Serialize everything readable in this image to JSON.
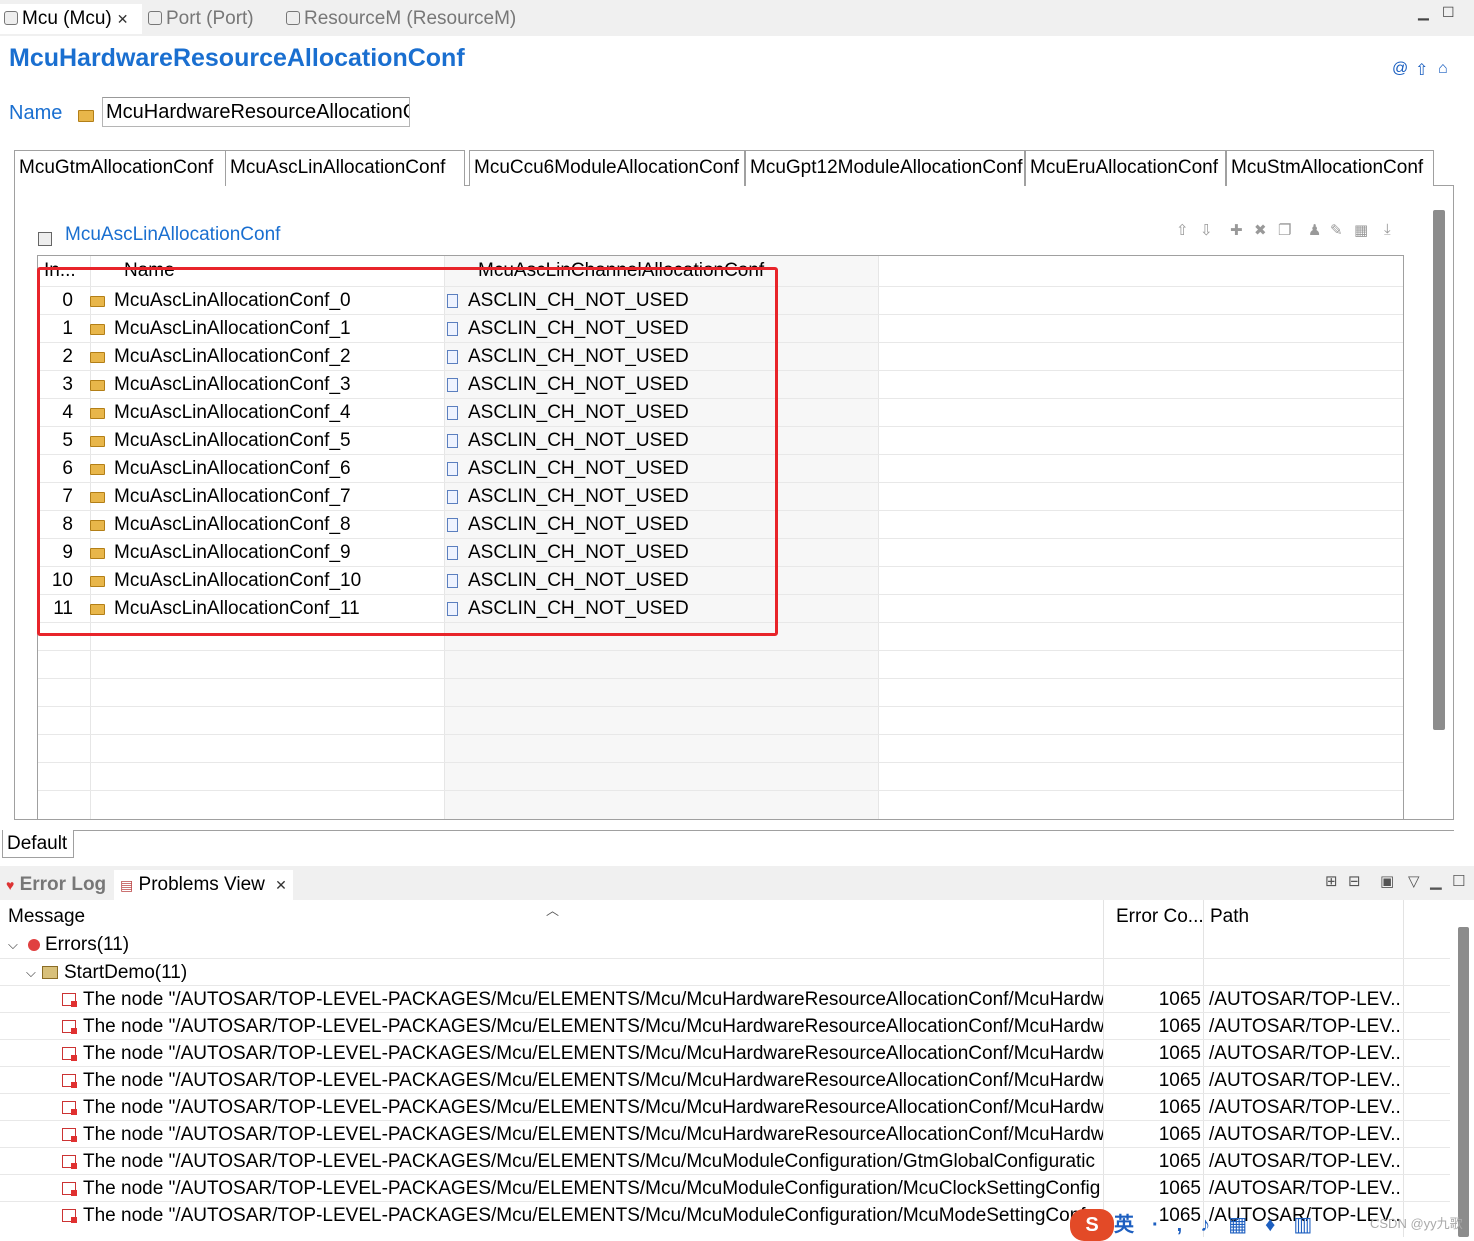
{
  "editor_tabs": [
    {
      "label": "Mcu (Mcu)",
      "active": true
    },
    {
      "label": "Port (Port)",
      "active": false
    },
    {
      "label": "ResourceM (ResourceM)",
      "active": false
    }
  ],
  "form": {
    "title": "McuHardwareResourceAllocationConf",
    "name_label": "Name",
    "name_value": "McuHardwareResourceAllocationConf"
  },
  "subtabs": [
    {
      "label": "McuGtmAllocationConf",
      "active": false
    },
    {
      "label": "McuAscLinAllocationConf",
      "active": true
    },
    {
      "label": "McuCcu6ModuleAllocationConf",
      "active": false
    },
    {
      "label": "McuGpt12ModuleAllocationConf",
      "active": false
    },
    {
      "label": "McuEruAllocationConf",
      "active": false
    },
    {
      "label": "McuStmAllocationConf",
      "active": false
    }
  ],
  "section": {
    "title": "McuAscLinAllocationConf",
    "columns": [
      "In...",
      "Name",
      "McuAscLinChannelAllocationConf"
    ],
    "rows": [
      {
        "index": "0",
        "name": "McuAscLinAllocationConf_0",
        "channel": "ASCLIN_CH_NOT_USED"
      },
      {
        "index": "1",
        "name": "McuAscLinAllocationConf_1",
        "channel": "ASCLIN_CH_NOT_USED"
      },
      {
        "index": "2",
        "name": "McuAscLinAllocationConf_2",
        "channel": "ASCLIN_CH_NOT_USED"
      },
      {
        "index": "3",
        "name": "McuAscLinAllocationConf_3",
        "channel": "ASCLIN_CH_NOT_USED"
      },
      {
        "index": "4",
        "name": "McuAscLinAllocationConf_4",
        "channel": "ASCLIN_CH_NOT_USED"
      },
      {
        "index": "5",
        "name": "McuAscLinAllocationConf_5",
        "channel": "ASCLIN_CH_NOT_USED"
      },
      {
        "index": "6",
        "name": "McuAscLinAllocationConf_6",
        "channel": "ASCLIN_CH_NOT_USED"
      },
      {
        "index": "7",
        "name": "McuAscLinAllocationConf_7",
        "channel": "ASCLIN_CH_NOT_USED"
      },
      {
        "index": "8",
        "name": "McuAscLinAllocationConf_8",
        "channel": "ASCLIN_CH_NOT_USED"
      },
      {
        "index": "9",
        "name": "McuAscLinAllocationConf_9",
        "channel": "ASCLIN_CH_NOT_USED"
      },
      {
        "index": "10",
        "name": "McuAscLinAllocationConf_10",
        "channel": "ASCLIN_CH_NOT_USED"
      },
      {
        "index": "11",
        "name": "McuAscLinAllocationConf_11",
        "channel": "ASCLIN_CH_NOT_USED"
      }
    ],
    "highlight_color": "#e8242a"
  },
  "bottom_tab": "Default",
  "views": {
    "tabs": [
      {
        "label": "Error Log",
        "active": false
      },
      {
        "label": "Problems View",
        "active": true
      }
    ],
    "columns": [
      "Message",
      "Error Co...",
      "Path"
    ],
    "errors_group": "Errors(11)",
    "project_group": "StartDemo(11)",
    "problems": [
      {
        "message": "The node \"/AUTOSAR/TOP-LEVEL-PACKAGES/Mcu/ELEMENTS/Mcu/McuHardwareResourceAllocationConf/McuHardw",
        "code": "1065",
        "path": "/AUTOSAR/TOP-LEV..."
      },
      {
        "message": "The node \"/AUTOSAR/TOP-LEVEL-PACKAGES/Mcu/ELEMENTS/Mcu/McuHardwareResourceAllocationConf/McuHardw",
        "code": "1065",
        "path": "/AUTOSAR/TOP-LEV..."
      },
      {
        "message": "The node \"/AUTOSAR/TOP-LEVEL-PACKAGES/Mcu/ELEMENTS/Mcu/McuHardwareResourceAllocationConf/McuHardw",
        "code": "1065",
        "path": "/AUTOSAR/TOP-LEV..."
      },
      {
        "message": "The node \"/AUTOSAR/TOP-LEVEL-PACKAGES/Mcu/ELEMENTS/Mcu/McuHardwareResourceAllocationConf/McuHardw",
        "code": "1065",
        "path": "/AUTOSAR/TOP-LEV..."
      },
      {
        "message": "The node \"/AUTOSAR/TOP-LEVEL-PACKAGES/Mcu/ELEMENTS/Mcu/McuHardwareResourceAllocationConf/McuHardw",
        "code": "1065",
        "path": "/AUTOSAR/TOP-LEV..."
      },
      {
        "message": "The node \"/AUTOSAR/TOP-LEVEL-PACKAGES/Mcu/ELEMENTS/Mcu/McuHardwareResourceAllocationConf/McuHardw",
        "code": "1065",
        "path": "/AUTOSAR/TOP-LEV..."
      },
      {
        "message": "The node \"/AUTOSAR/TOP-LEVEL-PACKAGES/Mcu/ELEMENTS/Mcu/McuModuleConfiguration/GtmGlobalConfiguratic",
        "code": "1065",
        "path": "/AUTOSAR/TOP-LEV..."
      },
      {
        "message": "The node \"/AUTOSAR/TOP-LEVEL-PACKAGES/Mcu/ELEMENTS/Mcu/McuModuleConfiguration/McuClockSettingConfig",
        "code": "1065",
        "path": "/AUTOSAR/TOP-LEV..."
      },
      {
        "message": "The node \"/AUTOSAR/TOP-LEVEL-PACKAGES/Mcu/ELEMENTS/Mcu/McuModuleConfiguration/McuModeSettingConf",
        "code": "1065",
        "path": "/AUTOSAR/TOP-LEV..."
      }
    ]
  },
  "ime": {
    "logo": "S",
    "lang": "英"
  },
  "watermark": "CSDN @yy九歌",
  "icons": [
    "close-icon",
    "minimize-icon",
    "maximize-icon",
    "folder-icon",
    "error-icon",
    "project-icon",
    "channel-icon"
  ]
}
